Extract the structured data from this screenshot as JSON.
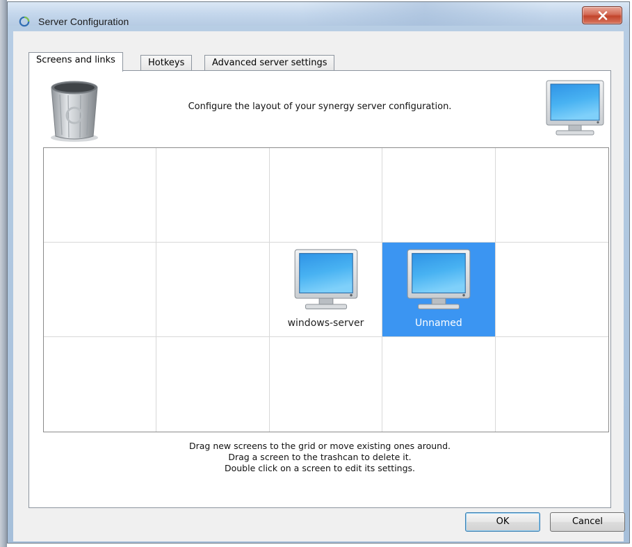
{
  "window": {
    "title": "Server Configuration",
    "close_glyph": "close-icon"
  },
  "tabs": [
    {
      "label": "Screens and links",
      "active": true
    },
    {
      "label": "Hotkeys",
      "active": false
    },
    {
      "label": "Advanced server settings",
      "active": false
    }
  ],
  "panel": {
    "heading": "Configure the layout of your synergy server configuration.",
    "trash_icon": "trashcan-icon",
    "new_screen_icon": "monitor-icon"
  },
  "grid": {
    "columns": 5,
    "rows": 3,
    "screens": [
      {
        "row": 1,
        "col": 2,
        "name": "windows-server",
        "selected": false
      },
      {
        "row": 1,
        "col": 3,
        "name": "Unnamed",
        "selected": true
      }
    ]
  },
  "help": {
    "line1": "Drag new screens to the grid or move existing ones around.",
    "line2": "Drag a screen to the trashcan to delete it.",
    "line3": "Double click on a screen to edit its settings."
  },
  "buttons": {
    "ok": "OK",
    "cancel": "Cancel"
  },
  "colors": {
    "selection": "#3b95f2",
    "close_button": "#c2442b"
  }
}
